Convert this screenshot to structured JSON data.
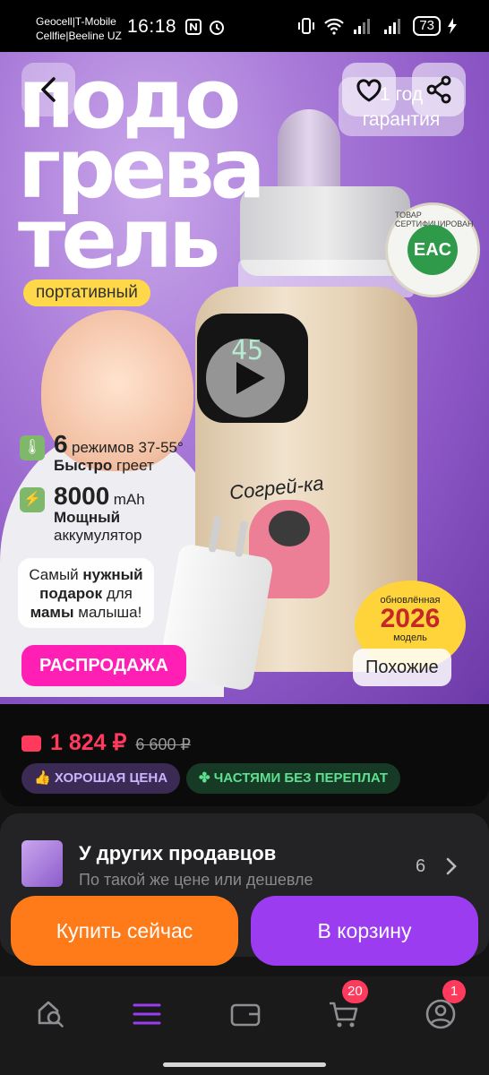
{
  "status_bar": {
    "carrier1": "Geocell|T-Mobile",
    "carrier2": "Cellfie|Beeline UZ",
    "time": "16:18",
    "battery": "73"
  },
  "hero": {
    "title_line1": "подо",
    "title_line2": "грева",
    "title_line3": "тель",
    "pill_portable": "портативный",
    "warranty_line1": "1 год",
    "warranty_line2": "гарантия",
    "eac_text": "ТОВАР СЕРТИФИЦИРОВАН",
    "eac_logo": "EAC",
    "screen_value": "45",
    "feature1_big": "6",
    "feature1_small": "режимов 37-55°",
    "feature1_bold": "Быстро",
    "feature1_rest": "греет",
    "feature2_big": "8000",
    "feature2_small": "mAh",
    "feature2_bold": "Мощный",
    "feature2_rest": "аккумулятор",
    "gift_text_1": "Самый",
    "gift_text_2": "нужный",
    "gift_text_3": "подарок",
    "gift_text_4": "для",
    "gift_text_5": "мамы",
    "gift_text_6": "малыша!",
    "sticker_text": "Согрей-ка",
    "badge_small_top": "обновлённая",
    "badge_year": "2026",
    "badge_small_bottom": "модель",
    "sale_label": "РАСПРОДАЖА",
    "similar_label": "Похожие"
  },
  "price": {
    "current": "1 824 ₽",
    "old": "6 600 ₽",
    "chip_good": "ХОРОШАЯ ЦЕНА",
    "chip_parts": "ЧАСТЯМИ БЕЗ ПЕРЕПЛАТ"
  },
  "sellers": {
    "title": "У других продавцов",
    "subtitle": "По такой же цене или дешевле",
    "count": "6"
  },
  "actions": {
    "buy_now": "Купить сейчас",
    "add_to_cart": "В корзину"
  },
  "tabbar": {
    "cart_badge": "20",
    "profile_badge": "1"
  },
  "colors": {
    "price_red": "#ff3a5c",
    "buy_orange": "#ff7b1a",
    "cart_purple": "#9b3cf0",
    "sale_pink": "#ff1fb4"
  },
  "icons": [
    "back-arrow-icon",
    "heart-icon",
    "share-icon",
    "play-icon",
    "thermometer-icon",
    "lightning-icon",
    "wallet-icon",
    "thumbs-up-icon",
    "clover-icon",
    "chevron-right-icon",
    "search-icon",
    "menu-icon",
    "wallet-tab-icon",
    "cart-icon",
    "profile-icon"
  ]
}
